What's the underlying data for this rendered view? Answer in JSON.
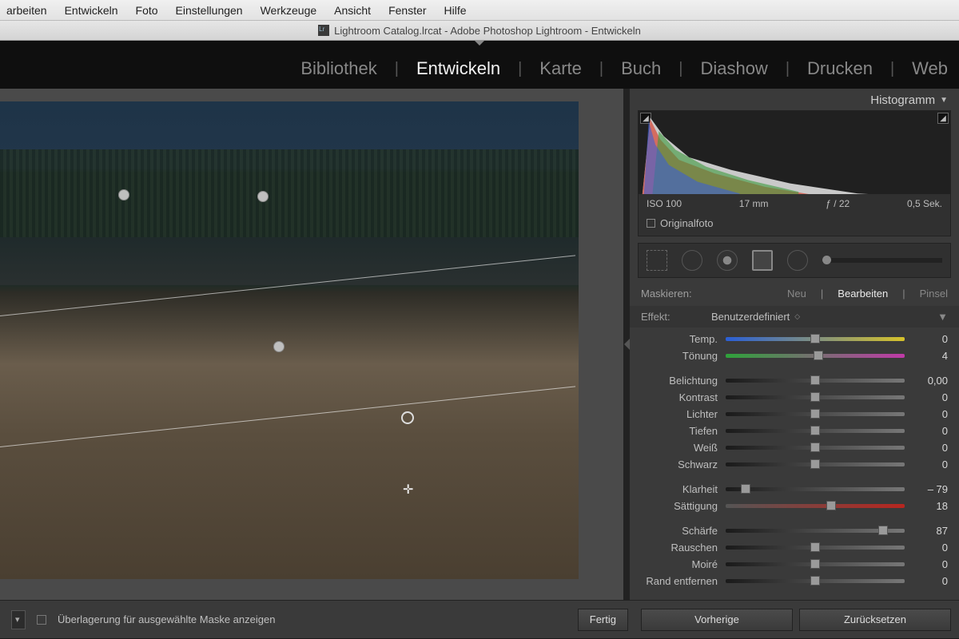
{
  "menubar": [
    "arbeiten",
    "Entwickeln",
    "Foto",
    "Einstellungen",
    "Werkzeuge",
    "Ansicht",
    "Fenster",
    "Hilfe"
  ],
  "window_title": "Lightroom Catalog.lrcat - Adobe Photoshop Lightroom - Entwickeln",
  "modules": {
    "items": [
      "Bibliothek",
      "Entwickeln",
      "Karte",
      "Buch",
      "Diashow",
      "Drucken",
      "Web"
    ],
    "active": "Entwickeln"
  },
  "histogram": {
    "title": "Histogramm",
    "iso": "ISO 100",
    "focal": "17 mm",
    "aperture": "ƒ / 22",
    "shutter": "0,5 Sek.",
    "original_label": "Originalfoto"
  },
  "mask": {
    "label": "Maskieren:",
    "new": "Neu",
    "edit": "Bearbeiten",
    "brush": "Pinsel"
  },
  "effect": {
    "label": "Effekt:",
    "value": "Benutzerdefiniert"
  },
  "sliders": {
    "temp": {
      "label": "Temp.",
      "value": "0",
      "pos": 50,
      "cls": "temp"
    },
    "tint": {
      "label": "Tönung",
      "value": "4",
      "pos": 52,
      "cls": "tint"
    },
    "exposure": {
      "label": "Belichtung",
      "value": "0,00",
      "pos": 50
    },
    "contrast": {
      "label": "Kontrast",
      "value": "0",
      "pos": 50
    },
    "highlights": {
      "label": "Lichter",
      "value": "0",
      "pos": 50
    },
    "shadows": {
      "label": "Tiefen",
      "value": "0",
      "pos": 50
    },
    "white": {
      "label": "Weiß",
      "value": "0",
      "pos": 50
    },
    "black": {
      "label": "Schwarz",
      "value": "0",
      "pos": 50
    },
    "clarity": {
      "label": "Klarheit",
      "value": "– 79",
      "pos": 11
    },
    "saturation": {
      "label": "Sättigung",
      "value": "18",
      "pos": 59,
      "cls": "sat"
    },
    "sharp": {
      "label": "Schärfe",
      "value": "87",
      "pos": 88
    },
    "noise": {
      "label": "Rauschen",
      "value": "0",
      "pos": 50
    },
    "moire": {
      "label": "Moiré",
      "value": "0",
      "pos": 50
    },
    "defringe": {
      "label": "Rand entfernen",
      "value": "0",
      "pos": 50
    }
  },
  "bottom": {
    "overlay": "Überlagerung für ausgewählte Maske anzeigen",
    "done": "Fertig",
    "prev": "Vorherige",
    "reset": "Zurücksetzen"
  }
}
